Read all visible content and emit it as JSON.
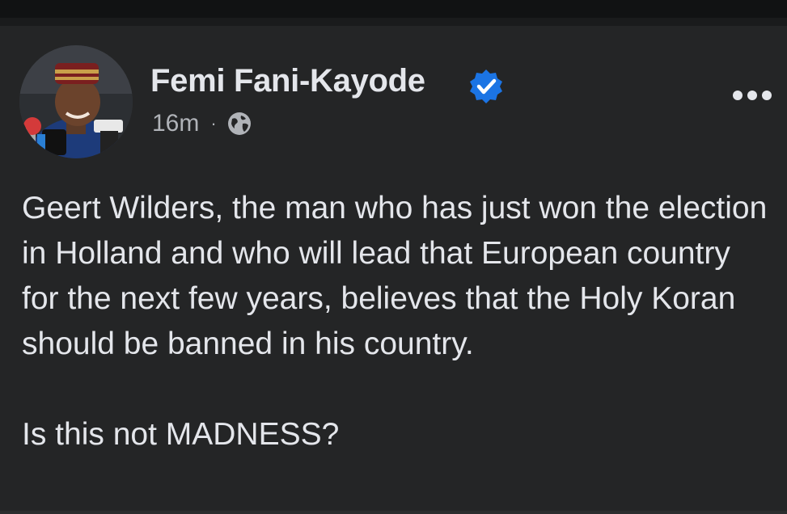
{
  "post": {
    "author": "Femi Fani-Kayode",
    "verified": true,
    "timestamp": "16m",
    "separator": "·",
    "audience_icon": "globe-icon",
    "more_icon": "more-options-icon",
    "text_paragraph_1": "Geert Wilders, the man who has just won the election in Holland and who will lead that European country for the next few years, believes that the Holy Koran should be banned in his country.",
    "text_paragraph_2": "Is this not MADNESS?"
  },
  "colors": {
    "background": "#242526",
    "primary_text": "#e4e6eb",
    "secondary_text": "#b0b3b8",
    "verified_badge": "#1b74e4"
  }
}
